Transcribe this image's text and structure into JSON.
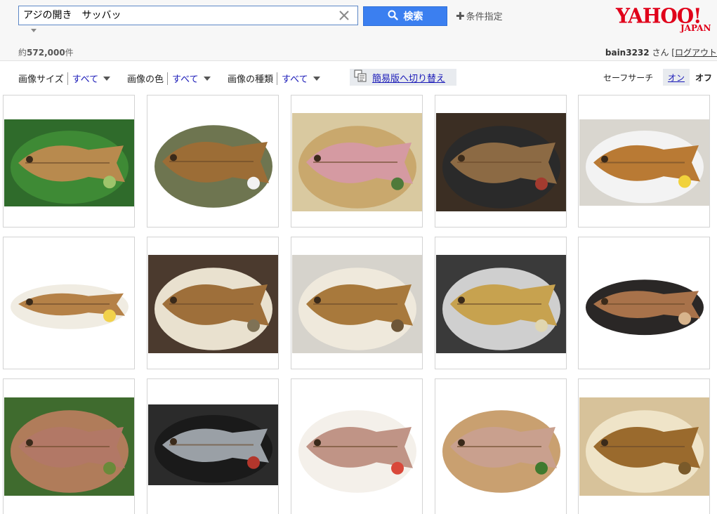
{
  "search": {
    "query": "アジの開き　サッバッ",
    "button_label": "検索",
    "conditions_label": "条件指定"
  },
  "results": {
    "count_prefix": "約",
    "count": "572,000",
    "count_suffix": "件"
  },
  "user": {
    "name": "bain3232",
    "honorific": "さん",
    "bracket": "[",
    "logout_label": "ログアウト"
  },
  "logo": {
    "main": "YAHOO!",
    "sub": "JAPAN"
  },
  "filters": {
    "size_label": "画像サイズ",
    "size_value": "すべて",
    "color_label": "画像の色",
    "color_value": "すべて",
    "type_label": "画像の種類",
    "type_value": "すべて",
    "simple_switch": "簡易版へ切り替え"
  },
  "safesearch": {
    "label": "セーフサーチ",
    "on": "オン",
    "off": "オフ"
  },
  "colors": {
    "accent": "#3b7ff0",
    "link": "#1a1ab8",
    "brand": "#e0001a"
  },
  "images": [
    {
      "bg": "#2f6b2b",
      "plate": "#3e8a35",
      "fish": "#b88a4e",
      "accent": "#9ec46b"
    },
    {
      "bg": "#ffffff",
      "plate": "#6e7550",
      "fish": "#9c6d36",
      "accent": "#f2f2f2"
    },
    {
      "bg": "#d9c9a0",
      "plate": "#c9a86d",
      "fish": "#d59aa2",
      "accent": "#4f7a3a"
    },
    {
      "bg": "#3b2e23",
      "plate": "#2a2a2a",
      "fish": "#8c6a44",
      "accent": "#a33b2f"
    },
    {
      "bg": "#d9d6cf",
      "plate": "#f3f3f3",
      "fish": "#b97a34",
      "accent": "#f1d23c"
    },
    {
      "bg": "#ffffff",
      "plate": "#f0ece2",
      "fish": "#b58147",
      "accent": "#f2d24a"
    },
    {
      "bg": "#4b3a2e",
      "plate": "#e9e1cf",
      "fish": "#9e6f3a",
      "accent": "#7f7256"
    },
    {
      "bg": "#d6d3cc",
      "plate": "#efe9dc",
      "fish": "#a8793c",
      "accent": "#6d5638"
    },
    {
      "bg": "#3a3a3a",
      "plate": "#cfcfcf",
      "fish": "#c7a24f",
      "accent": "#e0d6b0"
    },
    {
      "bg": "#ffffff",
      "plate": "#2a2726",
      "fish": "#a8724a",
      "accent": "#d8b48c"
    },
    {
      "bg": "#3f6b2e",
      "plate": "#b07c5a",
      "fish": "#b27866",
      "accent": "#6a8a3a"
    },
    {
      "bg": "#2b2b2b",
      "plate": "#1a1a1a",
      "fish": "#9aa0a6",
      "accent": "#b3362c"
    },
    {
      "bg": "#ffffff",
      "plate": "#f4f0ea",
      "fish": "#c09486",
      "accent": "#d9483a"
    },
    {
      "bg": "#ffffff",
      "plate": "#c9a070",
      "fish": "#c9a08e",
      "accent": "#3f7a2f"
    },
    {
      "bg": "#d7c29a",
      "plate": "#efe4c8",
      "fish": "#9a6a2d",
      "accent": "#7a5a2a"
    }
  ]
}
